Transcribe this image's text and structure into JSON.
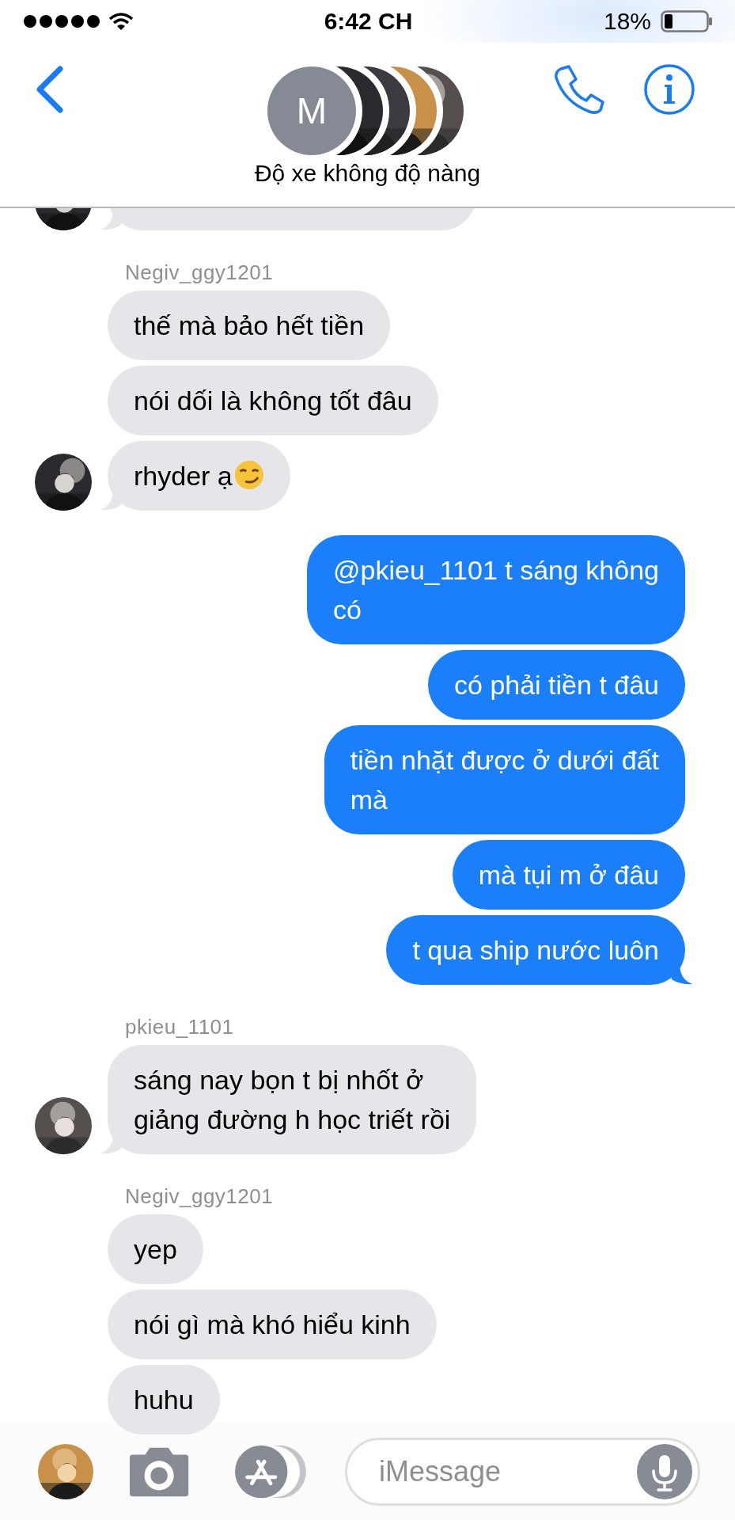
{
  "status_bar": {
    "time": "6:42 CH",
    "battery": "18%"
  },
  "header": {
    "group_initial": "M",
    "title": "Độ xe không độ nàng"
  },
  "messages": [
    {
      "kind": "clipped",
      "tail": true
    },
    {
      "kind": "sender",
      "text": "Negiv_ggy1201"
    },
    {
      "kind": "incoming",
      "text": "thế mà bảo hết tiền",
      "tail": false
    },
    {
      "kind": "incoming",
      "text": "nói dối là không tốt đâu",
      "tail": false
    },
    {
      "kind": "incoming",
      "text": "rhyder ạ",
      "emoji": true,
      "tail": true
    },
    {
      "kind": "outgoing",
      "text": "@pkieu_1101 t sáng không\ncó",
      "tail": false
    },
    {
      "kind": "outgoing",
      "text": "có phải tiền t đâu",
      "tail": false
    },
    {
      "kind": "outgoing",
      "text": "tiền nhặt được ở dưới đất\nmà",
      "tail": false
    },
    {
      "kind": "outgoing",
      "text": "mà tụi m ở đâu",
      "tail": false
    },
    {
      "kind": "outgoing",
      "text": "t qua ship nước luôn",
      "tail": true
    },
    {
      "kind": "sender",
      "text": "pkieu_1101"
    },
    {
      "kind": "incoming",
      "text": "sáng nay bọn t bị nhốt ở\ngiảng đường h học triết rồi",
      "tail": true
    },
    {
      "kind": "sender",
      "text": "Negiv_ggy1201"
    },
    {
      "kind": "incoming",
      "text": "yep",
      "tail": false
    },
    {
      "kind": "incoming",
      "text": "nói gì mà khó hiểu kinh",
      "tail": false
    },
    {
      "kind": "incoming",
      "text": "huhu",
      "tail": false
    }
  ],
  "composer": {
    "placeholder": "iMessage"
  }
}
